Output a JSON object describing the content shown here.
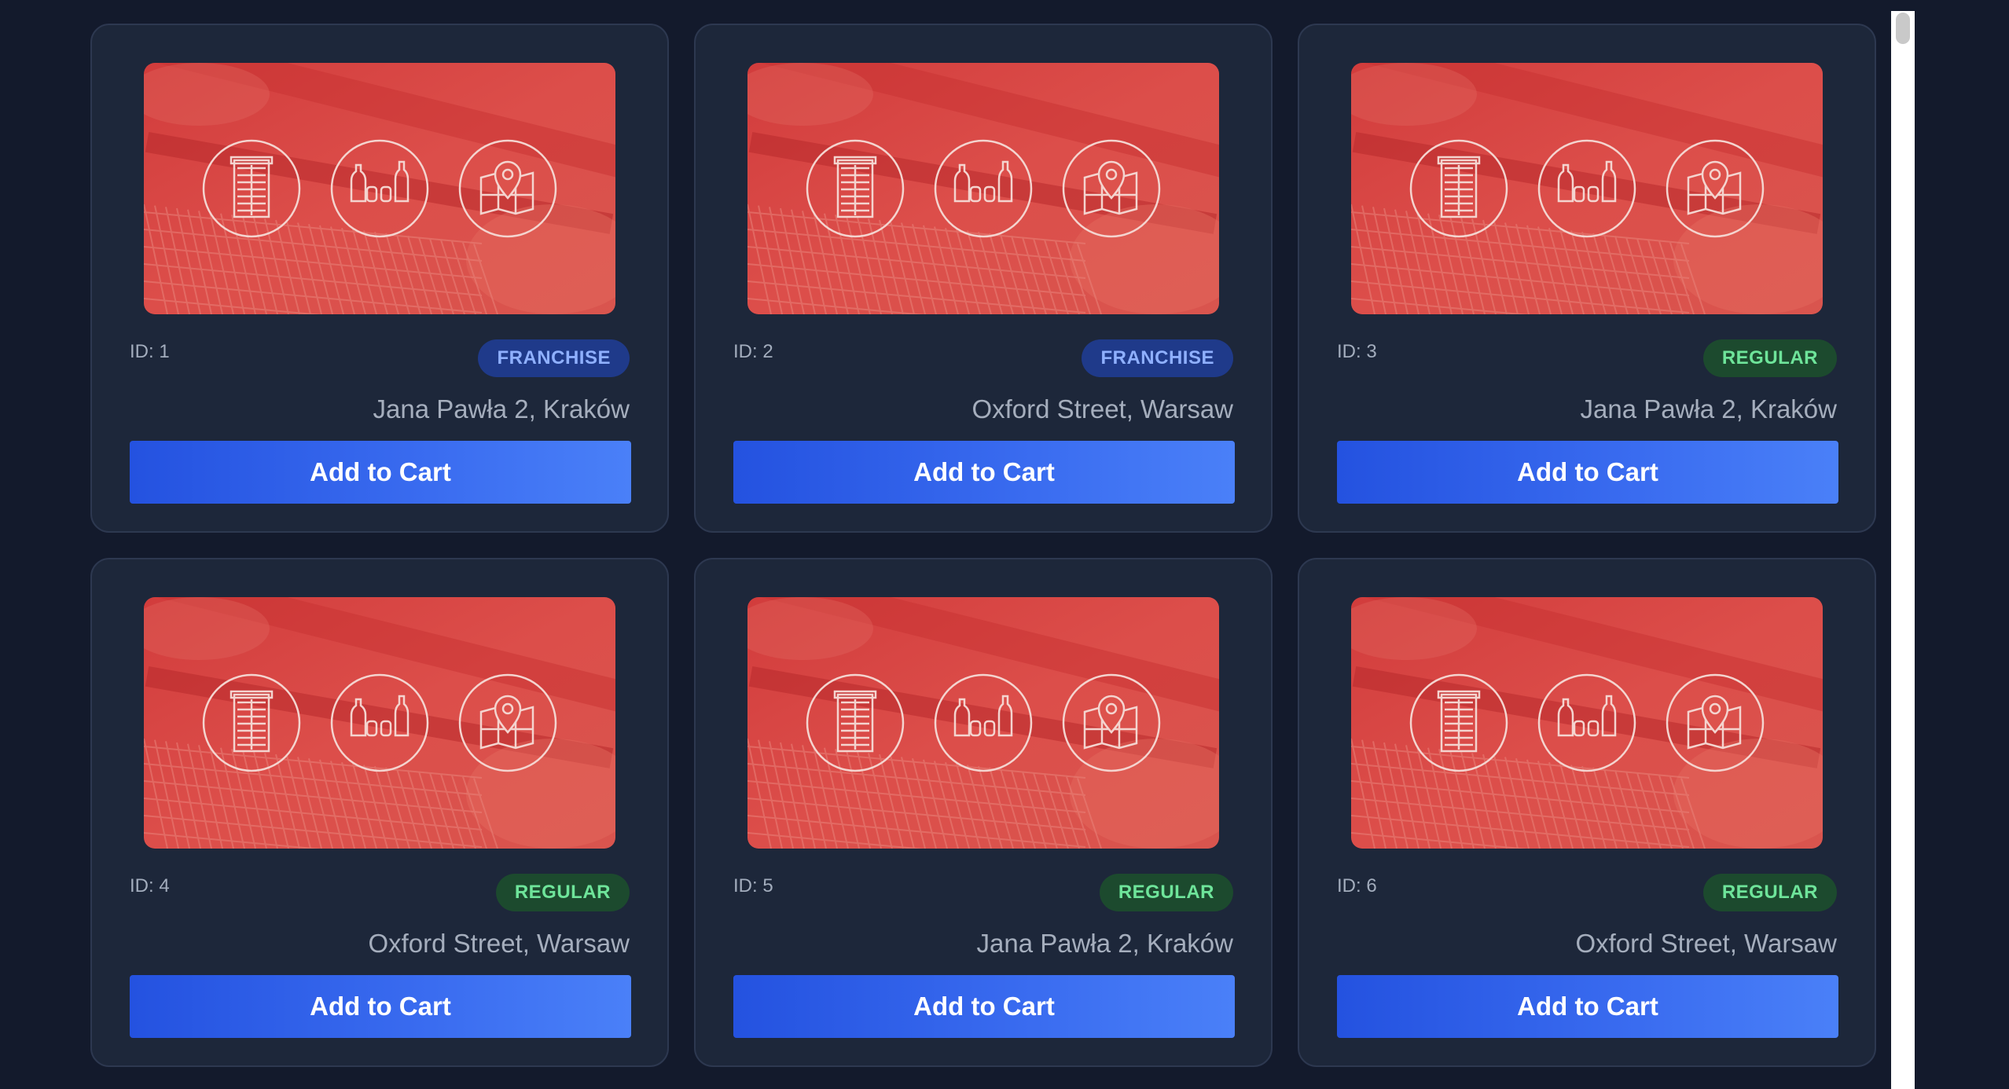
{
  "cards": [
    {
      "id_text": "ID: 1",
      "type": "FRANCHISE",
      "type_class": "franchise",
      "address": "Jana Pawła 2, Kraków",
      "button": "Add to Cart"
    },
    {
      "id_text": "ID: 2",
      "type": "FRANCHISE",
      "type_class": "franchise",
      "address": "Oxford Street, Warsaw",
      "button": "Add to Cart"
    },
    {
      "id_text": "ID: 3",
      "type": "REGULAR",
      "type_class": "regular",
      "address": "Jana Pawła 2, Kraków",
      "button": "Add to Cart"
    },
    {
      "id_text": "ID: 4",
      "type": "REGULAR",
      "type_class": "regular",
      "address": "Oxford Street, Warsaw",
      "button": "Add to Cart"
    },
    {
      "id_text": "ID: 5",
      "type": "REGULAR",
      "type_class": "regular",
      "address": "Jana Pawła 2, Kraków",
      "button": "Add to Cart"
    },
    {
      "id_text": "ID: 6",
      "type": "REGULAR",
      "type_class": "regular",
      "address": "Oxford Street, Warsaw",
      "button": "Add to Cart"
    }
  ],
  "image_icons": [
    "store-building-icon",
    "bottles-icon",
    "map-pin-icon"
  ],
  "colors": {
    "page_bg": "#131a2c",
    "card_bg": "#1d273a",
    "image_red": "#d94a48",
    "button_blue": "#2f5fe8",
    "franchise_badge": "#1f3a8a",
    "regular_badge": "#1c4a2e"
  }
}
